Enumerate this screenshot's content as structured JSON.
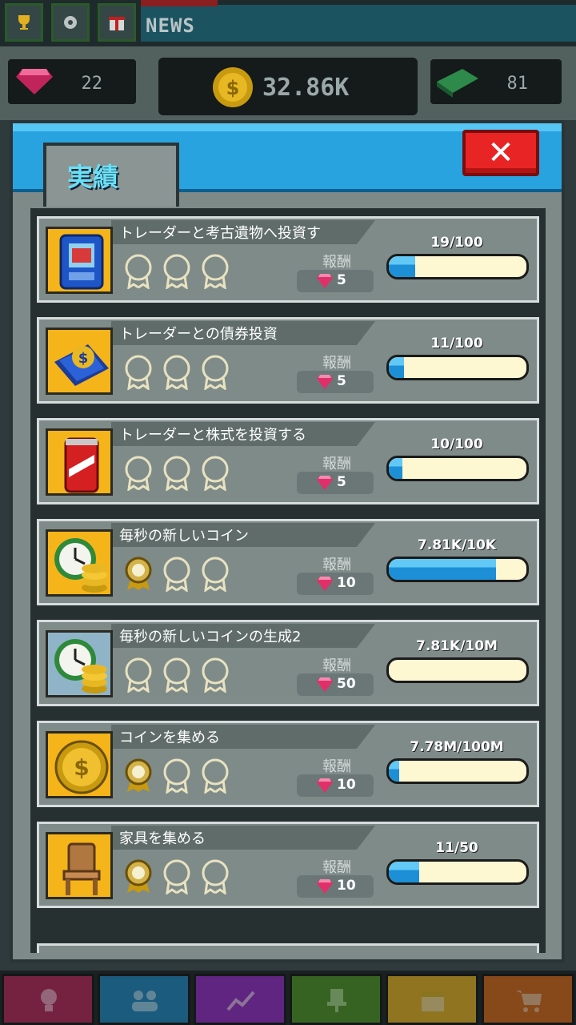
{
  "hud": {
    "news_label": "NEWS",
    "gems": "22",
    "coins": "32.86K",
    "cash": "81"
  },
  "panel": {
    "title": "実績",
    "close_label": "✕"
  },
  "reward_label": "報酬",
  "achievements": [
    {
      "name": "トレーダーと考古遺物へ投資す",
      "icon": "artifact-card-icon",
      "medals_earned": 0,
      "reward": "5",
      "progress_text": "19/100",
      "progress": 0.19
    },
    {
      "name": "トレーダーとの債券投資",
      "icon": "bond-certificate-icon",
      "medals_earned": 0,
      "reward": "5",
      "progress_text": "11/100",
      "progress": 0.11
    },
    {
      "name": "トレーダーと株式を投資する",
      "icon": "soda-can-icon",
      "medals_earned": 0,
      "reward": "5",
      "progress_text": "10/100",
      "progress": 0.1
    },
    {
      "name": "毎秒の新しいコイン",
      "icon": "clock-coins-icon",
      "medals_earned": 1,
      "reward": "10",
      "progress_text": "7.81K/10K",
      "progress": 0.781
    },
    {
      "name": "毎秒の新しいコインの生成2",
      "icon": "clock-coins-icon",
      "medals_earned": 0,
      "reward": "50",
      "progress_text": "7.81K/10M",
      "progress": 0.0008
    },
    {
      "name": "コインを集める",
      "icon": "gold-coin-icon",
      "medals_earned": 1,
      "reward": "10",
      "progress_text": "7.78M/100M",
      "progress": 0.078
    },
    {
      "name": "家具を集める",
      "icon": "chair-icon",
      "medals_earned": 1,
      "reward": "10",
      "progress_text": "11/50",
      "progress": 0.22
    }
  ],
  "bottom_nav": [
    {
      "name": "ideas",
      "icon": "lightbulb-icon",
      "color": "#c0245a"
    },
    {
      "name": "staff",
      "icon": "people-icon",
      "color": "#1c8cc8"
    },
    {
      "name": "market",
      "icon": "chart-icon",
      "color": "#9a2ad0"
    },
    {
      "name": "office",
      "icon": "office-chair-icon",
      "color": "#4e9a22"
    },
    {
      "name": "events",
      "icon": "calendar-icon",
      "color": "#f0b820"
    },
    {
      "name": "shop",
      "icon": "cart-icon",
      "color": "#e06a14"
    }
  ],
  "colors": {
    "header_blue": "#28a3e0",
    "progress_blue": "#1c8fd6",
    "gem_pink": "#e0306a",
    "close_red": "#e82424"
  }
}
